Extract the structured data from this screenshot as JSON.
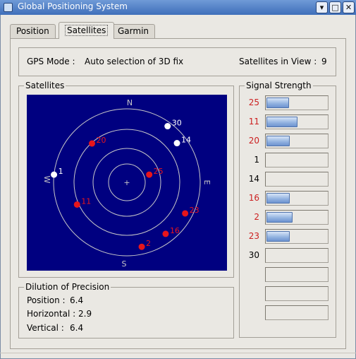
{
  "window": {
    "title": "Global Positioning System"
  },
  "tabs": [
    {
      "label": "Position",
      "active": false
    },
    {
      "label": "Satellites",
      "active": true
    },
    {
      "label": "Garmin",
      "active": false
    }
  ],
  "gps_mode": {
    "label": "GPS Mode :",
    "value": "Auto selection of 3D fix"
  },
  "satellites_in_view": {
    "label": "Satellites in View :",
    "value": "9"
  },
  "satellites_panel": {
    "title": "Satellites",
    "compass": {
      "north": "N",
      "south": "S",
      "east": "E",
      "west": "W"
    },
    "satellites": [
      {
        "id": "30",
        "used": false,
        "azimuth": 36,
        "elevation": 5
      },
      {
        "id": "14",
        "used": false,
        "azimuth": 52,
        "elevation": 12
      },
      {
        "id": "20",
        "used": true,
        "azimuth": 318,
        "elevation": 26
      },
      {
        "id": "25",
        "used": true,
        "azimuth": 71,
        "elevation": 61
      },
      {
        "id": "1",
        "used": false,
        "azimuth": 276,
        "elevation": 0
      },
      {
        "id": "11",
        "used": true,
        "azimuth": 246,
        "elevation": 23
      },
      {
        "id": "23",
        "used": true,
        "azimuth": 118,
        "elevation": 9
      },
      {
        "id": "16",
        "used": true,
        "azimuth": 143,
        "elevation": 11
      },
      {
        "id": "2",
        "used": true,
        "azimuth": 167,
        "elevation": 9
      }
    ]
  },
  "signal_panel": {
    "title": "Signal Strength",
    "rows": [
      {
        "sat": "25",
        "used": true,
        "level": 0.36
      },
      {
        "sat": "11",
        "used": true,
        "level": 0.5
      },
      {
        "sat": "20",
        "used": true,
        "level": 0.38
      },
      {
        "sat": "1",
        "used": false,
        "level": 0
      },
      {
        "sat": "14",
        "used": false,
        "level": 0
      },
      {
        "sat": "16",
        "used": true,
        "level": 0.38
      },
      {
        "sat": "2",
        "used": true,
        "level": 0.42
      },
      {
        "sat": "23",
        "used": true,
        "level": 0.37
      },
      {
        "sat": "30",
        "used": false,
        "level": 0
      },
      {
        "sat": "",
        "used": false,
        "level": 0
      },
      {
        "sat": "",
        "used": false,
        "level": 0
      },
      {
        "sat": "",
        "used": false,
        "level": 0
      }
    ]
  },
  "dop": {
    "title": "Dilution of Precision",
    "position": {
      "label": "Position :",
      "value": "6.4"
    },
    "horizontal": {
      "label": "Horizontal :",
      "value": "2.9"
    },
    "vertical": {
      "label": "Vertical :",
      "value": "6.4"
    }
  },
  "colors": {
    "used": "#e8151b",
    "unused": "#ffffff",
    "sky": "#000080",
    "ring": "#c8c8c8",
    "label_used": "#cc2020",
    "label_unused": "#000000"
  }
}
